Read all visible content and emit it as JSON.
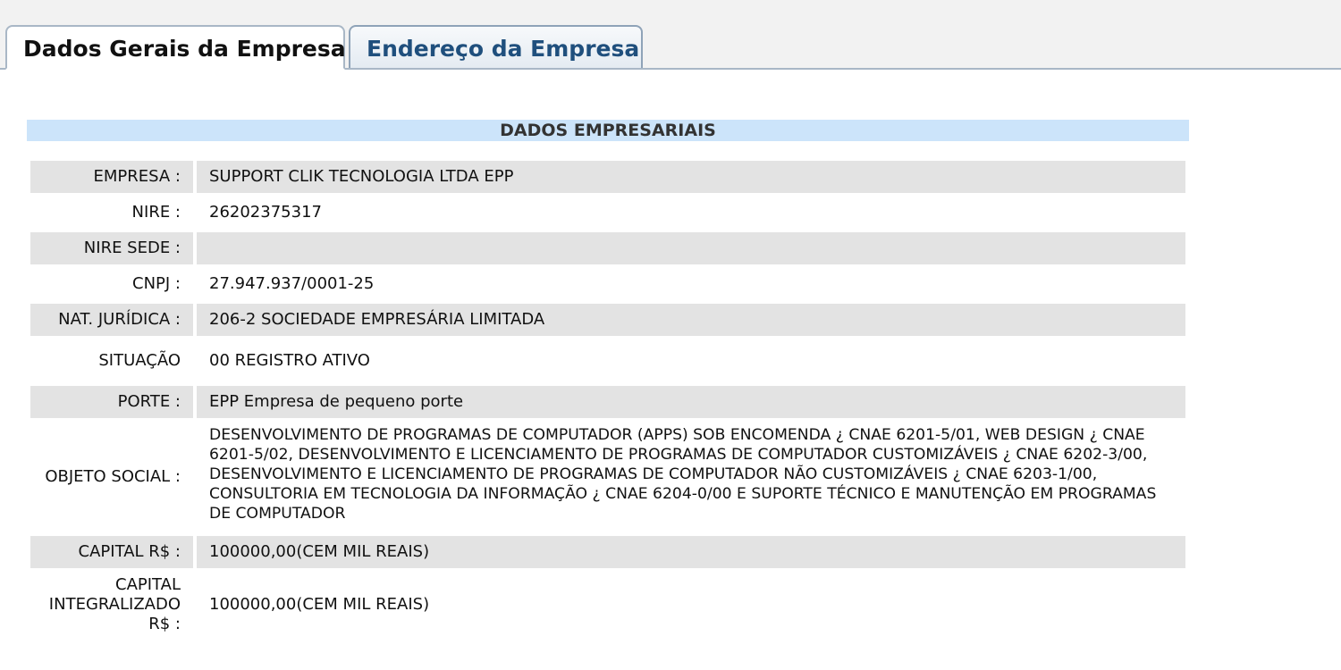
{
  "tabs": [
    {
      "label": "Dados Gerais da Empresa",
      "active": true
    },
    {
      "label": "Endereço da Empresa",
      "active": false
    }
  ],
  "section": {
    "title": "DADOS EMPRESARIAIS"
  },
  "fields": [
    {
      "label": "EMPRESA :",
      "value": "SUPPORT CLIK TECNOLOGIA LTDA EPP"
    },
    {
      "label": "NIRE :",
      "value": "26202375317"
    },
    {
      "label": "NIRE SEDE :",
      "value": ""
    },
    {
      "label": "CNPJ :",
      "value": "27.947.937/0001-25"
    },
    {
      "label": "NAT. JURÍDICA :",
      "value": "206-2 SOCIEDADE EMPRESÁRIA LIMITADA"
    },
    {
      "label": "SITUAÇÃO",
      "value": "00 REGISTRO ATIVO"
    },
    {
      "label": "PORTE :",
      "value": "EPP Empresa de pequeno porte"
    },
    {
      "label": "OBJETO SOCIAL :",
      "value": "DESENVOLVIMENTO DE PROGRAMAS DE COMPUTADOR (APPS) SOB ENCOMENDA ¿ CNAE 6201-5/01, WEB DESIGN ¿ CNAE 6201-5/02, DESENVOLVIMENTO E LICENCIAMENTO DE PROGRAMAS DE COMPUTADOR CUSTOMIZÁVEIS ¿ CNAE 6202-3/00, DESENVOLVIMENTO E LICENCIAMENTO DE PROGRAMAS DE COMPUTADOR NÃO CUSTOMIZÁVEIS ¿ CNAE 6203-1/00, CONSULTORIA EM TECNOLOGIA DA INFORMAÇÃO ¿ CNAE 6204-0/00 E SUPORTE TÉCNICO E MANUTENÇÃO EM PROGRAMAS DE COMPUTADOR"
    },
    {
      "label": "CAPITAL R$ :",
      "value": "100000,00(CEM MIL REAIS)"
    },
    {
      "label": "CAPITAL INTEGRALIZADO R$ :",
      "value": "100000,00(CEM MIL REAIS)"
    }
  ]
}
